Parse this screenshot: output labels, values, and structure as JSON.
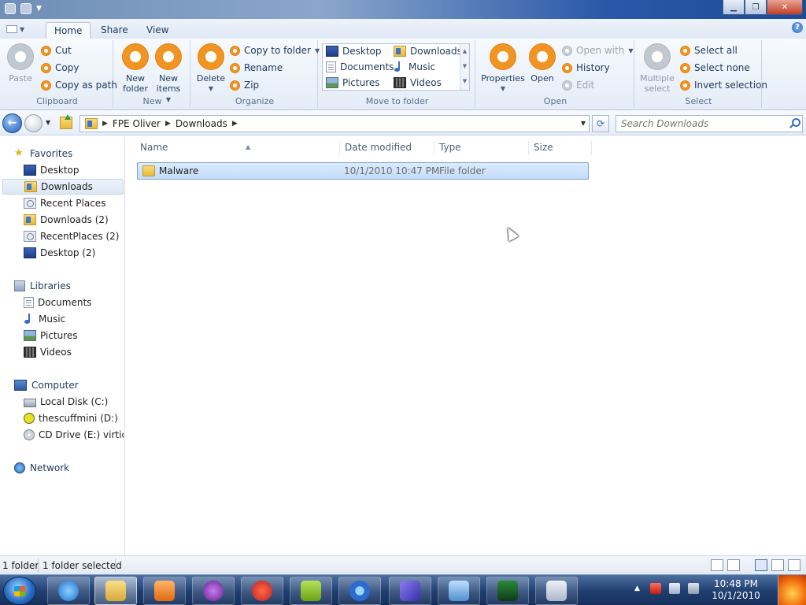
{
  "ribbon": {
    "tabs": [
      {
        "label": "Home",
        "active": true
      },
      {
        "label": "Share",
        "active": false
      },
      {
        "label": "View",
        "active": false
      }
    ],
    "clipboard": {
      "label": "Clipboard",
      "paste": "Paste",
      "cut": "Cut",
      "copy": "Copy",
      "copy_as_path": "Copy as path"
    },
    "new": {
      "label": "New",
      "new_folder_line1": "New",
      "new_folder_line2": "folder",
      "new_items_line1": "New",
      "new_items_line2": "items"
    },
    "organize": {
      "label": "Organize",
      "delete": "Delete",
      "copy_to_folder": "Copy to folder",
      "rename": "Rename",
      "zip": "Zip"
    },
    "move_to_folder": {
      "label": "Move to folder",
      "items": [
        "Desktop",
        "Downloads",
        "Documents",
        "Music",
        "Pictures",
        "Videos"
      ]
    },
    "open": {
      "label": "Open",
      "properties": "Properties",
      "open": "Open",
      "open_with": "Open with",
      "history": "History",
      "edit": "Edit"
    },
    "select": {
      "label": "Select",
      "multiple_line1": "Multiple",
      "multiple_line2": "select",
      "select_all": "Select all",
      "select_none": "Select none",
      "invert_selection": "Invert selection"
    }
  },
  "address": {
    "crumbs": [
      "FPE Oliver",
      "Downloads"
    ],
    "search_placeholder": "Search Downloads"
  },
  "navpane": {
    "favorites": {
      "label": "Favorites",
      "items": [
        "Desktop",
        "Downloads",
        "Recent Places",
        "Downloads (2)",
        "RecentPlaces (2)",
        "Desktop (2)"
      ]
    },
    "libraries": {
      "label": "Libraries",
      "items": [
        "Documents",
        "Music",
        "Pictures",
        "Videos"
      ]
    },
    "computer": {
      "label": "Computer",
      "items": [
        "Local Disk (C:)",
        "thescuffmini (D:)",
        "CD Drive (E:) virtio-v"
      ]
    },
    "network": {
      "label": "Network"
    }
  },
  "filelist": {
    "columns": [
      "Name",
      "Date modified",
      "Type",
      "Size"
    ],
    "rows": [
      {
        "name": "Malware",
        "date_modified": "10/1/2010 10:47 PM",
        "type": "File folder",
        "size": ""
      }
    ]
  },
  "statusbar": {
    "count": "1 folder",
    "selection": "1 folder selected"
  },
  "taskbar": {
    "time": "10:48 PM",
    "date": "10/1/2010"
  },
  "colors": {
    "accent_orange": "#f29422",
    "selection_blue": "#c3dcf9",
    "taskbar": "#1f3e6f"
  },
  "icons": {
    "ribbon": "orange-circle-icon",
    "folder": "folder-icon",
    "back": "back-arrow-icon",
    "search": "search-icon"
  }
}
